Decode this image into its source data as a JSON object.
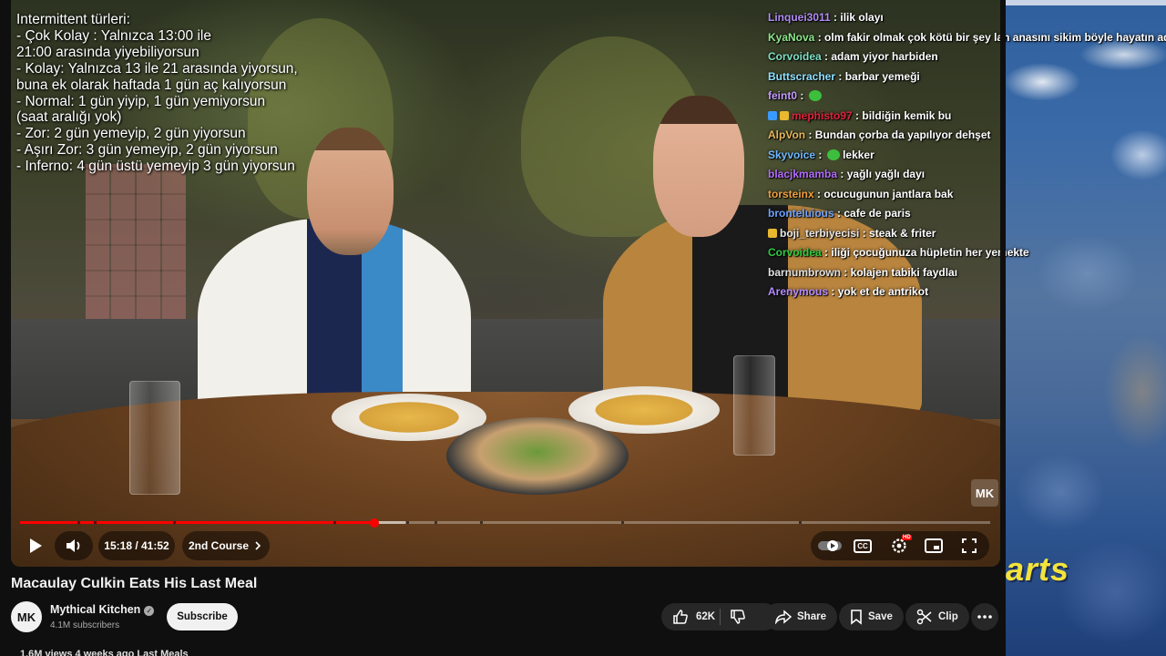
{
  "overlay": {
    "text": "Intermittent türleri:\n- Çok Kolay : Yalnızca 13:00 ile\n21:00 arasında yiyebiliyorsun\n- Kolay: Yalnızca 13 ile 21 arasında yiyorsun,\nbuna ek olarak haftada 1 gün aç kalıyorsun\n- Normal: 1 gün yiyip, 1 gün yemiyorsun\n(saat aralığı yok)\n- Zor: 2 gün yemeyip, 2 gün yiyorsun\n- Aşırı Zor: 3 gün yemeyip, 2 gün yiyorsun\n- Inferno: 4 gün üstü yemeyip 3 gün yiyorsun"
  },
  "chat": [
    {
      "user": "Linquei3011",
      "color": "#b18cf5",
      "msg": "ilik olayı"
    },
    {
      "user": "KyaNova",
      "color": "#8de68a",
      "msg": "olm fakir olmak çok kötü bir şey lan anasını sikim böyle hayatın aq"
    },
    {
      "user": "Corvoidea",
      "color": "#7ee0c4",
      "msg": "adam yiyor harbiden"
    },
    {
      "user": "Buttscracher",
      "color": "#8fe0ff",
      "msg": "barbar yemeği"
    },
    {
      "user": "feint0",
      "color": "#c49bff",
      "msg": "",
      "emote": "pepe"
    },
    {
      "user": "mephisto97",
      "color": "#e0233c",
      "msg": "bildiğin kemik bu",
      "badges": [
        "#3a9bff",
        "#e8b830"
      ]
    },
    {
      "user": "AlpVon",
      "color": "#e6b85c",
      "msg": "Bundan çorba da yapılıyor dehşet"
    },
    {
      "user": "Skyvoice",
      "color": "#6fb8ff",
      "msg": "lekker",
      "emote": "pepe"
    },
    {
      "user": "blacjkmamba",
      "color": "#b36cff",
      "msg": "yağlı yağlı dayı"
    },
    {
      "user": "torsteinx",
      "color": "#f0a040",
      "msg": "ocucugunun jantlara bak"
    },
    {
      "user": "bronteluious",
      "color": "#6fa3ff",
      "msg": "cafe de paris"
    },
    {
      "user": "boji_terbiyecisi",
      "color": "#e8e8e8",
      "msg": "steak & friter",
      "badges": [
        "#e8b830"
      ]
    },
    {
      "user": "Corvoidea",
      "color": "#2ecc40",
      "msg": "iliği çocuğunuza hüpletin her yemekte"
    },
    {
      "user": "barnumbrown",
      "color": "#e0e0e0",
      "msg": "kolajen tabiki faydlaı"
    },
    {
      "user": "Arenymous",
      "color": "#b58cff",
      "msg": "yok et de antrikot"
    }
  ],
  "player": {
    "time": "15:18 / 41:52",
    "chapter": "2nd Course",
    "progress_fraction": 0.3655,
    "buffer_fraction": 0.397,
    "watermark": "MK",
    "cc_label": "CC",
    "hd_badge": "HD"
  },
  "video": {
    "title": "Macaulay Culkin Eats His Last Meal"
  },
  "channel": {
    "avatar_text": "MK",
    "name": "Mythical Kitchen",
    "subscribers": "4.1M subscribers",
    "subscribe_label": "Subscribe"
  },
  "actions": {
    "likes": "62K",
    "share": "Share",
    "save": "Save",
    "clip": "Clip"
  },
  "meta": {
    "views_line": "1.6M views  4 weeks ago  Last Meals"
  },
  "wallpaper": {
    "text": "arts"
  },
  "colors": {
    "accent": "#ff0000",
    "page_bg": "#0f0f0f",
    "pill_bg": "#272727"
  }
}
